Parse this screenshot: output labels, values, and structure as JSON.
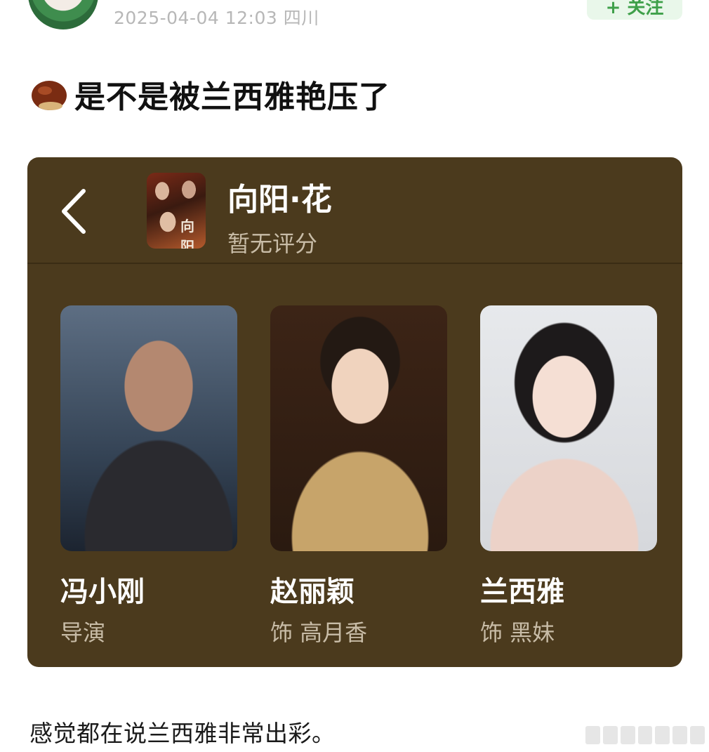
{
  "header": {
    "timestamp": "2025-04-04 12:03 四川",
    "follow_label": "+ 关注"
  },
  "post": {
    "title_icon": "chestnut-icon",
    "title": "是不是被兰西雅艳压了",
    "body": "感觉都在说兰西雅非常出彩。"
  },
  "card": {
    "background": "#4b3a1d",
    "back_icon": "chevron-left-icon",
    "movie_title": "向阳·花",
    "rating": "暂无评分",
    "poster_glyph": "向阳",
    "people": [
      {
        "name": "冯小刚",
        "role": "导演"
      },
      {
        "name": "赵丽颖",
        "role": "饰 高月香"
      },
      {
        "name": "兰西雅",
        "role": "饰 黑妹"
      }
    ]
  },
  "colors": {
    "accent_green": "#3fa04a",
    "muted_text": "#c8bca7"
  }
}
